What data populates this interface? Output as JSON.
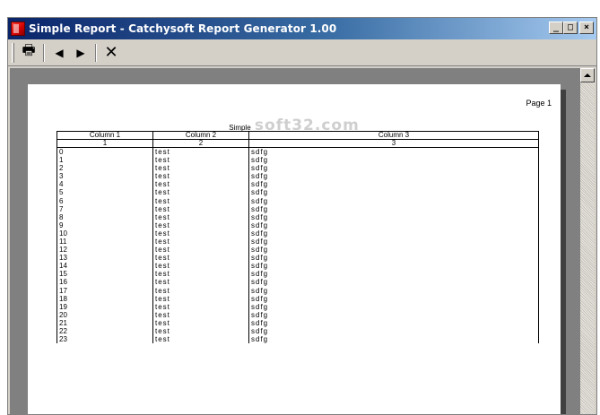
{
  "window": {
    "title": "Simple Report - Catchysoft Report Generator 1.00",
    "controls": {
      "minimize": "_",
      "maximize": "□",
      "close": "×"
    }
  },
  "toolbar": {
    "buttons": [
      {
        "name": "print",
        "icon": "printer-icon",
        "glyph": "🖶"
      },
      {
        "name": "previous",
        "icon": "left-arrow-icon",
        "glyph": "◀"
      },
      {
        "name": "next",
        "icon": "right-arrow-icon",
        "glyph": "▶"
      },
      {
        "name": "close",
        "icon": "close-icon",
        "glyph": "✕"
      }
    ]
  },
  "report": {
    "page_label": "Page 1",
    "title": "Simple",
    "watermark": "soft32.com",
    "headers": [
      "Column 1",
      "Column 2",
      "Column 3"
    ],
    "subheaders": [
      "1",
      "2",
      "3"
    ],
    "rows": [
      [
        "0",
        "test",
        "sdfg"
      ],
      [
        "1",
        "test",
        "sdfg"
      ],
      [
        "2",
        "test",
        "sdfg"
      ],
      [
        "3",
        "test",
        "sdfg"
      ],
      [
        "4",
        "test",
        "sdfg"
      ],
      [
        "5",
        "test",
        "sdfg"
      ],
      [
        "6",
        "test",
        "sdfg"
      ],
      [
        "7",
        "test",
        "sdfg"
      ],
      [
        "8",
        "test",
        "sdfg"
      ],
      [
        "9",
        "test",
        "sdfg"
      ],
      [
        "10",
        "test",
        "sdfg"
      ],
      [
        "11",
        "test",
        "sdfg"
      ],
      [
        "12",
        "test",
        "sdfg"
      ],
      [
        "13",
        "test",
        "sdfg"
      ],
      [
        "14",
        "test",
        "sdfg"
      ],
      [
        "15",
        "test",
        "sdfg"
      ],
      [
        "16",
        "test",
        "sdfg"
      ],
      [
        "17",
        "test",
        "sdfg"
      ],
      [
        "18",
        "test",
        "sdfg"
      ],
      [
        "19",
        "test",
        "sdfg"
      ],
      [
        "20",
        "test",
        "sdfg"
      ],
      [
        "21",
        "test",
        "sdfg"
      ],
      [
        "22",
        "test",
        "sdfg"
      ],
      [
        "23",
        "test",
        "sdfg"
      ]
    ]
  },
  "colors": {
    "titlebar_start": "#0a246a",
    "titlebar_end": "#a6caf0",
    "workspace": "#808080",
    "chrome": "#d4d0c8"
  }
}
